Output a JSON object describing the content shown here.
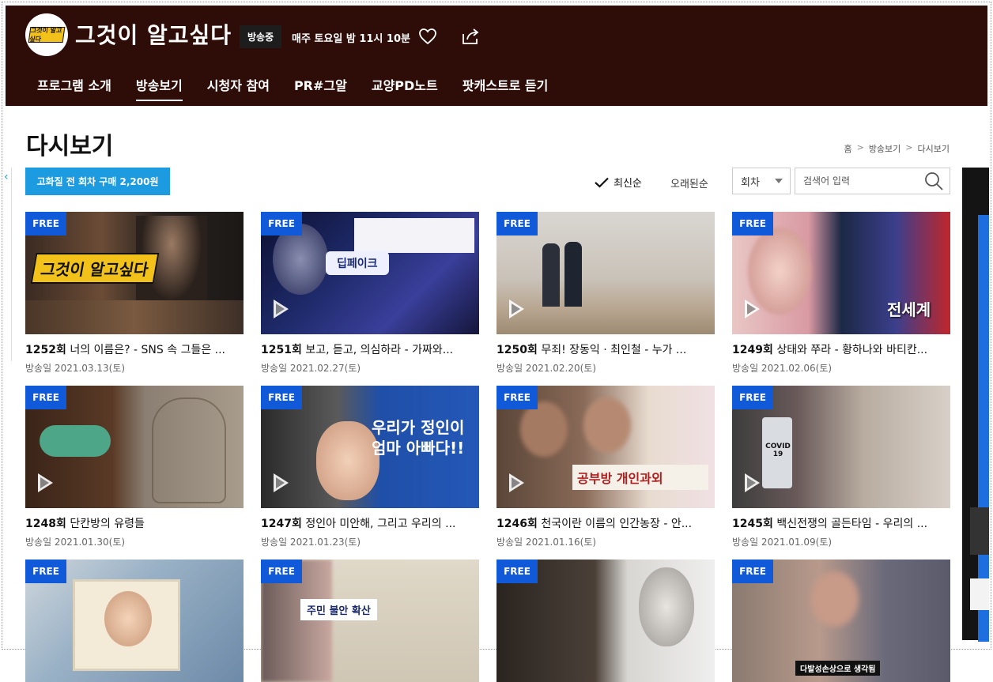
{
  "header": {
    "program_title": "그것이 알고싶다",
    "logo_text": "그것이 알고싶다",
    "onair_badge": "방송중",
    "schedule": "매주 토요일 밤 11시 10분",
    "nav": [
      "프로그램 소개",
      "방송보기",
      "시청자 참여",
      "PR#그알",
      "교양PD노트",
      "팟캐스트로 듣기"
    ],
    "active_nav_index": 1
  },
  "page_title": "다시보기",
  "breadcrumb": [
    "홈",
    "방송보기",
    "다시보기"
  ],
  "breadcrumb_separator": ">",
  "toolbar": {
    "buy_all_label": "고화질 전 회차 구매 2,200원",
    "sort_latest_label": "최신순",
    "sort_oldest_label": "오래된순",
    "select_value": "회차",
    "search_placeholder": "검색어 입력"
  },
  "free_badge": "FREE",
  "episodes": [
    {
      "no": "1252회",
      "title": "너의 이름은? - SNS 속 그들은 ...",
      "date": "방송일 2021.03.13(토)",
      "thumb_text": "그것이 알고싶다"
    },
    {
      "no": "1251회",
      "title": "보고, 듣고, 의심하라 - 가짜와...",
      "date": "방송일 2021.02.27(토)",
      "thumb_text": "딥페이크"
    },
    {
      "no": "1250회",
      "title": "무죄! 장동익 · 최인철 - 누가 ...",
      "date": "방송일 2021.02.20(토)",
      "thumb_text": ""
    },
    {
      "no": "1249회",
      "title": "상태와 쭈라 - 황하나와 바티칸...",
      "date": "방송일 2021.02.06(토)",
      "thumb_text": "전세계"
    },
    {
      "no": "1248회",
      "title": "단칸방의 유령들",
      "date": "방송일 2021.01.30(토)",
      "thumb_text": ""
    },
    {
      "no": "1247회",
      "title": "정인아 미안해, 그리고 우리의 ...",
      "date": "방송일 2021.01.23(토)",
      "thumb_text": "우리가 정인이 엄마 아빠다!!"
    },
    {
      "no": "1246회",
      "title": "천국이란 이름의 인간농장 - 안...",
      "date": "방송일 2021.01.16(토)",
      "thumb_text": "공부방 개인과외"
    },
    {
      "no": "1245회",
      "title": "백신전쟁의 골든타임 - 우리의 ...",
      "date": "방송일 2021.01.09(토)",
      "thumb_text": "COVID 19"
    },
    {
      "no": "",
      "title": "",
      "date": "",
      "thumb_text": ""
    },
    {
      "no": "",
      "title": "",
      "date": "",
      "thumb_text": "주민 불안 확산"
    },
    {
      "no": "",
      "title": "",
      "date": "",
      "thumb_text": ""
    },
    {
      "no": "",
      "title": "",
      "date": "",
      "thumb_text": "다발성손상으로 생각됨"
    }
  ],
  "colors": {
    "header_bg": "#2e0c08",
    "accent_blue": "#1d9be0",
    "free_badge_bg": "#1059d8"
  }
}
